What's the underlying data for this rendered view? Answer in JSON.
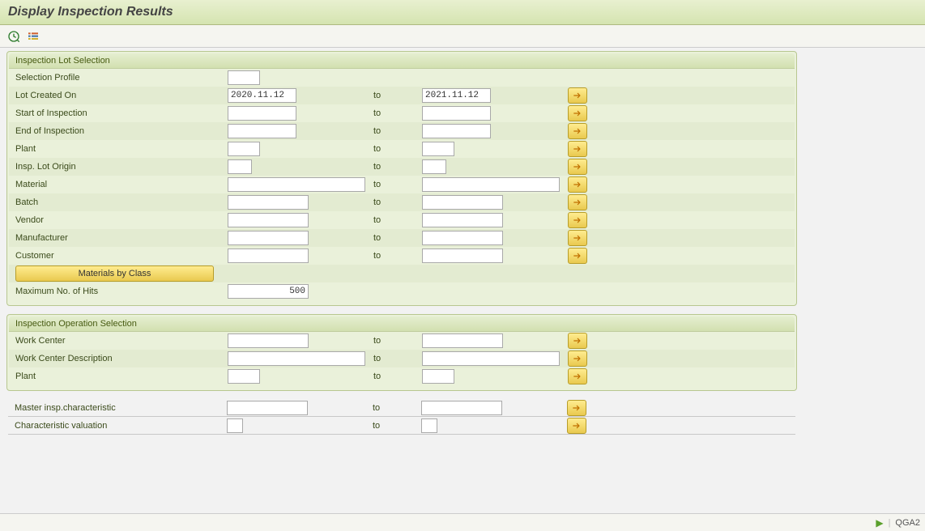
{
  "title": "Display Inspection Results",
  "toolbar": {
    "execute_icon": "execute-icon",
    "variant_icon": "variant-icon"
  },
  "labels": {
    "to": "to"
  },
  "group1": {
    "title": "Inspection Lot Selection",
    "fields": {
      "selection_profile": {
        "label": "Selection Profile",
        "from": "",
        "to": ""
      },
      "lot_created_on": {
        "label": "Lot Created On",
        "from": "2020.11.12",
        "to": "2021.11.12"
      },
      "start_inspection": {
        "label": "Start of Inspection",
        "from": "",
        "to": ""
      },
      "end_inspection": {
        "label": "End of Inspection",
        "from": "",
        "to": ""
      },
      "plant": {
        "label": "Plant",
        "from": "",
        "to": ""
      },
      "lot_origin": {
        "label": "Insp. Lot Origin",
        "from": "",
        "to": ""
      },
      "material": {
        "label": "Material",
        "from": "",
        "to": ""
      },
      "batch": {
        "label": "Batch",
        "from": "",
        "to": ""
      },
      "vendor": {
        "label": "Vendor",
        "from": "",
        "to": ""
      },
      "manufacturer": {
        "label": "Manufacturer",
        "from": "",
        "to": ""
      },
      "customer": {
        "label": "Customer",
        "from": "",
        "to": ""
      }
    },
    "materials_by_class": "Materials by Class",
    "max_hits": {
      "label": "Maximum No. of Hits",
      "value": "500"
    }
  },
  "group2": {
    "title": "Inspection Operation Selection",
    "fields": {
      "work_center": {
        "label": "Work Center",
        "from": "",
        "to": ""
      },
      "work_center_desc": {
        "label": "Work Center Description",
        "from": "",
        "to": ""
      },
      "plant": {
        "label": "Plant",
        "from": "",
        "to": ""
      }
    }
  },
  "group3": {
    "fields": {
      "master_char": {
        "label": "Master insp.characteristic",
        "from": "",
        "to": ""
      },
      "char_val": {
        "label": "Characteristic valuation",
        "from": "",
        "to": ""
      }
    }
  },
  "statusbar": {
    "system": "QGA2"
  }
}
